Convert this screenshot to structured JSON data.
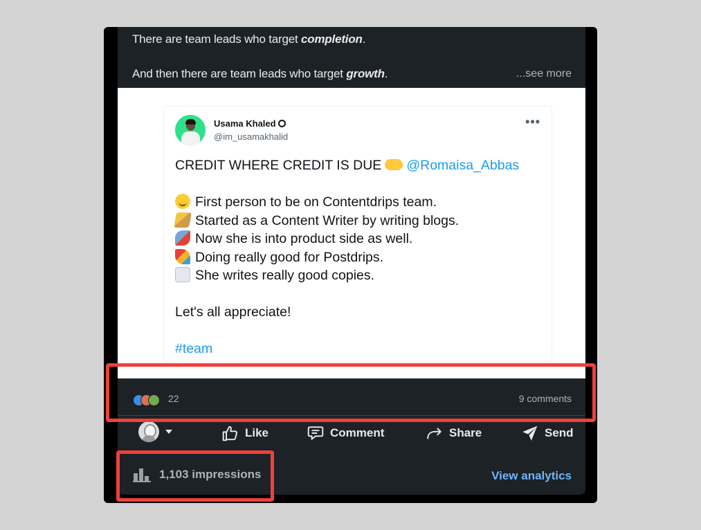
{
  "post": {
    "caption_line1_prefix": "There are team leads who target ",
    "caption_line1_em": "completion",
    "caption_line1_suffix": ".",
    "caption_line2_prefix": "And then there are team leads who target ",
    "caption_line2_em": "growth",
    "caption_line2_suffix": ".",
    "see_more": "...see more"
  },
  "tweet": {
    "author_name": "Usama Khaled",
    "author_handle": "@im_usamakhalid",
    "more_label": "•••",
    "headline_prefix": "CREDIT WHERE CREDIT IS DUE",
    "headline_mention": "@Romaisa_Abbas",
    "lines": [
      {
        "emoji": "smiling-face",
        "text": "First person to be on Contentdrips team."
      },
      {
        "emoji": "writing-hand",
        "text": "Started as a Content Writer by writing blogs."
      },
      {
        "emoji": "rocket",
        "text": "Now she is into product side as well."
      },
      {
        "emoji": "party-popper",
        "text": "Doing really good for Postdrips."
      },
      {
        "emoji": "page",
        "text": "She writes really good copies."
      }
    ],
    "closing": "Let's all appreciate!",
    "hashtag": "#team"
  },
  "social": {
    "reaction_count": "22",
    "comments": "9 comments"
  },
  "actions": {
    "like": "Like",
    "comment": "Comment",
    "share": "Share",
    "send": "Send"
  },
  "analytics": {
    "impressions": "1,103 impressions",
    "view_analytics": "View analytics"
  },
  "colors": {
    "highlight": "#f0403b",
    "link": "#70b5f9",
    "tweet_link": "#1d9bf0",
    "card_bg": "#1d2226"
  }
}
